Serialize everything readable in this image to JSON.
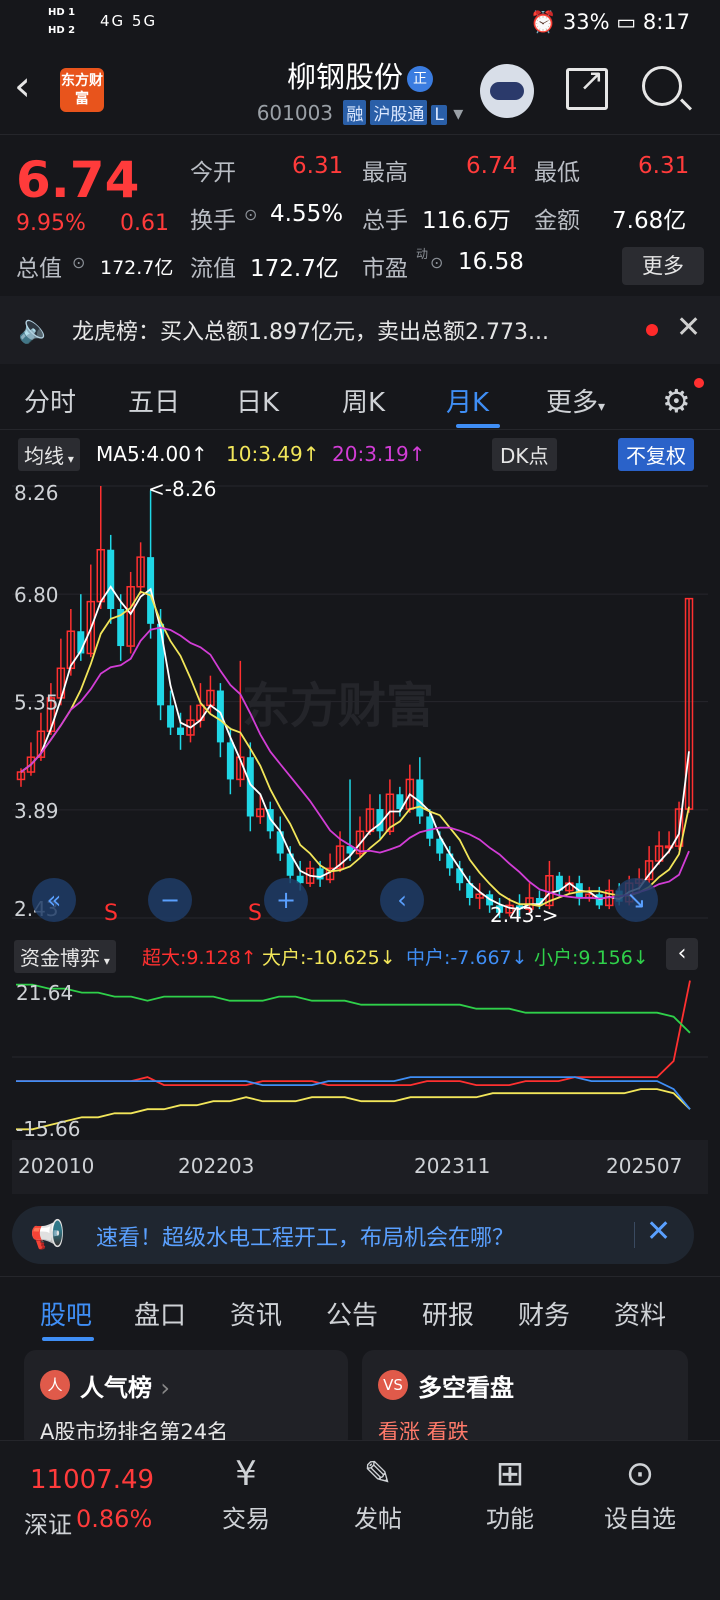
{
  "status": {
    "hd": [
      "HD 1",
      "HD 2"
    ],
    "signal": "4G  5G",
    "battery": "33%",
    "time": "8:17"
  },
  "header": {
    "logo_text": "东方财富",
    "stock_name": "柳钢股份",
    "badge": "正",
    "code": "601003",
    "tags": [
      "融",
      "沪股通",
      "L"
    ]
  },
  "quote": {
    "price": "6.74",
    "change_pct": "9.95%",
    "change": "0.61",
    "open_label": "今开",
    "open": "6.31",
    "high_label": "最高",
    "high": "6.74",
    "low_label": "最低",
    "low": "6.31",
    "turnover_label": "换手",
    "turnover": "4.55%",
    "volume_label": "总手",
    "volume": "116.6万",
    "amount_label": "金额",
    "amount": "7.68亿",
    "mktcap_label": "总值",
    "mktcap": "172.7亿",
    "float_label": "流值",
    "float": "172.7亿",
    "pe_label": "市盈",
    "pe_sup": "动",
    "pe": "16.58",
    "more": "更多"
  },
  "notice": {
    "text": "龙虎榜：买入总额1.897亿元，卖出总额2.773..."
  },
  "k_tabs": [
    "分时",
    "五日",
    "日K",
    "周K",
    "月K",
    "更多"
  ],
  "k_active": "月K",
  "chart_head": {
    "ma_btn": "均线",
    "ma5": "MA5:4.00↑",
    "ma10": "10:3.49↑",
    "ma20": "20:3.19↑",
    "dk": "DK点",
    "fq": "不复权"
  },
  "chart_data": {
    "type": "candlestick",
    "ylim": [
      2.43,
      8.26
    ],
    "y_ticks": [
      "8.26",
      "6.80",
      "5.35",
      "3.89",
      "2.43"
    ],
    "max_label": "<-8.26",
    "min_label": "2.43->",
    "signal_marks": [
      "S",
      "S"
    ],
    "colors": {
      "up": "#ff3030",
      "down": "#1fd7e6",
      "ma5": "#ffffff",
      "ma10": "#f2e65a",
      "ma20": "#d23dd6"
    },
    "candles": [
      [
        4.3,
        4.4,
        4.2,
        4.45
      ],
      [
        4.4,
        4.6,
        4.35,
        4.8
      ],
      [
        4.6,
        4.95,
        4.55,
        5.2
      ],
      [
        4.95,
        5.4,
        4.9,
        5.6
      ],
      [
        5.4,
        5.8,
        5.3,
        6.2
      ],
      [
        5.8,
        6.3,
        5.7,
        6.6
      ],
      [
        6.3,
        6.0,
        5.9,
        6.8
      ],
      [
        6.0,
        6.7,
        5.95,
        7.2
      ],
      [
        6.7,
        7.4,
        6.6,
        8.26
      ],
      [
        7.4,
        6.6,
        6.4,
        7.6
      ],
      [
        6.6,
        6.1,
        5.9,
        6.8
      ],
      [
        6.1,
        6.9,
        6.0,
        7.1
      ],
      [
        6.9,
        7.3,
        6.8,
        7.5
      ],
      [
        7.3,
        6.4,
        6.2,
        8.2
      ],
      [
        6.4,
        5.3,
        5.1,
        6.6
      ],
      [
        5.3,
        5.0,
        4.9,
        5.5
      ],
      [
        5.0,
        4.9,
        4.7,
        5.2
      ],
      [
        4.9,
        5.1,
        4.8,
        5.3
      ],
      [
        5.1,
        5.3,
        5.0,
        5.6
      ],
      [
        5.3,
        5.5,
        5.2,
        5.7
      ],
      [
        5.5,
        4.8,
        4.6,
        5.6
      ],
      [
        4.8,
        4.3,
        4.1,
        5.0
      ],
      [
        4.3,
        4.6,
        4.2,
        5.9
      ],
      [
        4.6,
        3.8,
        3.6,
        4.8
      ],
      [
        3.8,
        3.9,
        3.7,
        4.1
      ],
      [
        3.9,
        3.6,
        3.5,
        4.0
      ],
      [
        3.6,
        3.3,
        3.2,
        3.8
      ],
      [
        3.3,
        3.0,
        2.9,
        3.4
      ],
      [
        3.0,
        2.9,
        2.8,
        3.2
      ],
      [
        2.9,
        3.1,
        2.85,
        3.2
      ],
      [
        3.1,
        2.95,
        2.85,
        3.2
      ],
      [
        2.95,
        3.1,
        2.9,
        3.3
      ],
      [
        3.1,
        3.4,
        3.05,
        3.6
      ],
      [
        3.4,
        3.3,
        3.2,
        4.3
      ],
      [
        3.3,
        3.6,
        3.25,
        3.8
      ],
      [
        3.6,
        3.9,
        3.55,
        4.1
      ],
      [
        3.9,
        3.6,
        3.5,
        4.1
      ],
      [
        3.6,
        4.1,
        3.55,
        4.3
      ],
      [
        4.1,
        3.9,
        3.8,
        4.2
      ],
      [
        3.9,
        4.3,
        3.85,
        4.5
      ],
      [
        4.3,
        3.8,
        3.7,
        4.6
      ],
      [
        3.8,
        3.5,
        3.4,
        3.9
      ],
      [
        3.5,
        3.3,
        3.2,
        3.6
      ],
      [
        3.3,
        3.1,
        3.0,
        3.4
      ],
      [
        3.1,
        2.9,
        2.8,
        3.2
      ],
      [
        2.9,
        2.7,
        2.6,
        3.0
      ],
      [
        2.7,
        2.75,
        2.55,
        2.9
      ],
      [
        2.75,
        2.6,
        2.5,
        2.8
      ],
      [
        2.6,
        2.5,
        2.43,
        2.7
      ],
      [
        2.5,
        2.6,
        2.45,
        2.7
      ],
      [
        2.6,
        2.55,
        2.45,
        2.75
      ],
      [
        2.55,
        2.7,
        2.5,
        2.9
      ],
      [
        2.7,
        2.6,
        2.55,
        2.8
      ],
      [
        2.6,
        3.0,
        2.55,
        3.2
      ],
      [
        3.0,
        2.8,
        2.7,
        3.05
      ],
      [
        2.8,
        2.9,
        2.75,
        3.0
      ],
      [
        2.9,
        2.7,
        2.6,
        3.0
      ],
      [
        2.7,
        2.75,
        2.65,
        2.85
      ],
      [
        2.75,
        2.6,
        2.55,
        2.85
      ],
      [
        2.6,
        2.8,
        2.55,
        2.95
      ],
      [
        2.8,
        2.65,
        2.6,
        2.9
      ],
      [
        2.65,
        2.9,
        2.6,
        3.0
      ],
      [
        2.9,
        2.95,
        2.8,
        3.1
      ],
      [
        2.95,
        3.2,
        2.9,
        3.4
      ],
      [
        3.2,
        3.4,
        3.15,
        3.6
      ],
      [
        3.4,
        3.4,
        3.3,
        3.6
      ],
      [
        3.4,
        3.9,
        3.35,
        4.0
      ],
      [
        3.9,
        6.74,
        3.85,
        6.74
      ]
    ],
    "nav_controls": [
      "«",
      "−",
      "+",
      "‹",
      "↘"
    ]
  },
  "sub_chart": {
    "title": "资金博弈",
    "super": "超大:9.128↑",
    "big": "大户:-10.625↓",
    "mid": "中户:-7.667↓",
    "small": "小户:9.156↓",
    "y_top": "21.64",
    "y_bottom": "-15.66",
    "series": [
      {
        "name": "超大",
        "color": "#ff3030",
        "values": [
          -3,
          -3,
          -3,
          -3,
          -3,
          -3,
          -3,
          -3,
          -2,
          -4,
          -4,
          -4,
          -4,
          -4,
          -4,
          -3,
          -3,
          -3,
          -3,
          -4,
          -4,
          -4,
          -4,
          -4,
          -4,
          -3,
          -3,
          -3,
          -4,
          -4,
          -4,
          -3,
          -3,
          -3,
          -2,
          -2,
          -2,
          -2,
          -2,
          -2,
          2,
          22
        ]
      },
      {
        "name": "大户",
        "color": "#f2e65a",
        "values": [
          -15,
          -15,
          -14,
          -13,
          -12,
          -12,
          -11,
          -11,
          -10,
          -10,
          -9,
          -9,
          -8,
          -8,
          -7,
          -8,
          -8,
          -8,
          -7,
          -7,
          -7,
          -8,
          -8,
          -8,
          -7,
          -7,
          -7,
          -7,
          -7,
          -6,
          -6,
          -6,
          -6,
          -6,
          -6,
          -6,
          -6,
          -6,
          -5,
          -5,
          -6,
          -10
        ]
      },
      {
        "name": "中户",
        "color": "#3f8ef5",
        "values": [
          -3,
          -3,
          -3,
          -3,
          -3,
          -3,
          -3,
          -3,
          -3,
          -3,
          -3,
          -3,
          -3,
          -3,
          -3,
          -4,
          -4,
          -4,
          -4,
          -3,
          -3,
          -3,
          -3,
          -3,
          -2,
          -2,
          -2,
          -2,
          -2,
          -2,
          -2,
          -2,
          -2,
          -2,
          -2,
          -3,
          -3,
          -3,
          -3,
          -3,
          -5,
          -10
        ]
      },
      {
        "name": "小户",
        "color": "#2fd04a",
        "values": [
          21,
          21,
          20,
          20,
          19,
          19,
          18,
          18,
          17,
          18,
          18,
          18,
          18,
          17,
          17,
          17,
          18,
          18,
          17,
          17,
          17,
          16,
          16,
          16,
          16,
          16,
          16,
          16,
          15,
          15,
          15,
          14,
          14,
          14,
          14,
          14,
          14,
          14,
          14,
          14,
          13,
          9
        ]
      }
    ]
  },
  "dates": [
    "202010",
    "202203",
    "202311",
    "202507"
  ],
  "ad": {
    "text": "速看！超级水电工程开工，布局机会在哪？"
  },
  "bottom_tabs": [
    "股吧",
    "盘口",
    "资讯",
    "公告",
    "研报",
    "财务",
    "资料"
  ],
  "cards": [
    {
      "icon": "人",
      "title": "人气榜",
      "sub": "A股市场排名第24名"
    },
    {
      "icon": "VS",
      "title": "多空看盘",
      "sub": "看涨  看跌"
    }
  ],
  "bottom_nav": {
    "index_value": "11007.49",
    "index_name": "深证",
    "index_pct": "0.86%",
    "items": [
      "交易",
      "发帖",
      "功能",
      "设自选"
    ]
  }
}
